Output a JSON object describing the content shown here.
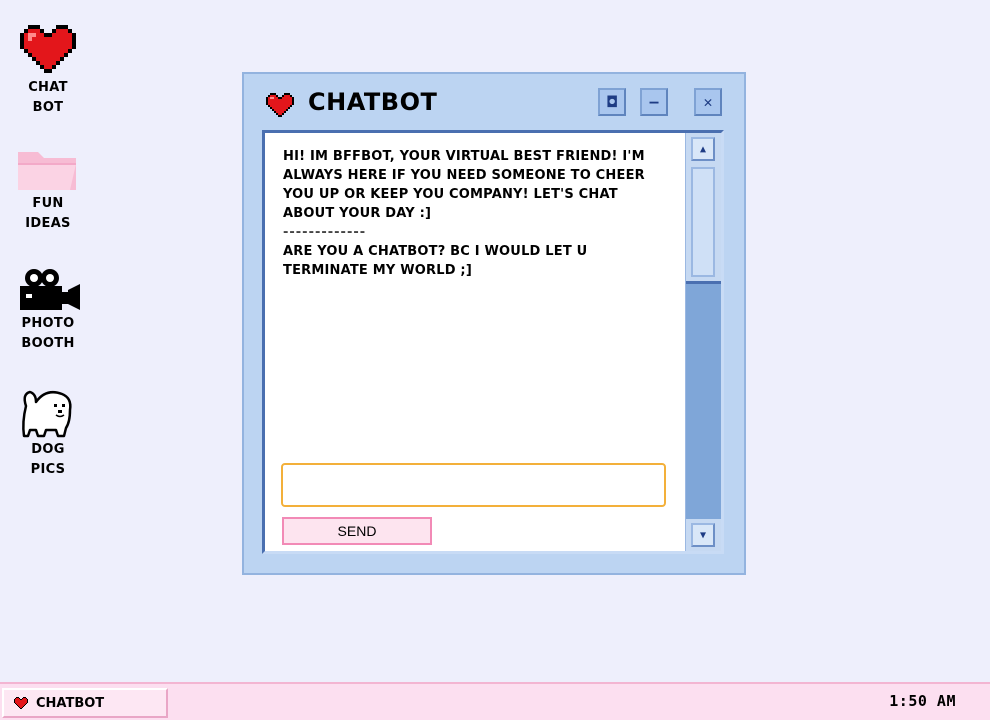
{
  "desktop": {
    "icons": [
      {
        "label": "CHAT\nBOT",
        "icon": "heart-icon"
      },
      {
        "label": "FUN\nIDEAS",
        "icon": "folder-icon"
      },
      {
        "label": "PHOTO\nBOOTH",
        "icon": "camera-icon"
      },
      {
        "label": "DOG\nPICS",
        "icon": "dog-icon"
      }
    ]
  },
  "window": {
    "title": "CHATBOT",
    "buttons": {
      "maximize": "◘",
      "minimize": "–",
      "close": "✕"
    },
    "messages": [
      "HI! IM BFFBOT, YOUR VIRTUAL BEST FRIEND! I'M ALWAYS HERE IF YOU NEED SOMEONE TO CHEER YOU UP OR KEEP YOU COMPANY! LET'S CHAT ABOUT YOUR DAY :]",
      "ARE YOU A CHATBOT? BC I WOULD LET U TERMINATE MY WORLD ;]"
    ],
    "divider": "-------------",
    "input": {
      "value": "",
      "placeholder": ""
    },
    "send_label": "SEND",
    "scroll_up": "▲",
    "scroll_down": "▼"
  },
  "taskbar": {
    "task_label": "CHATBOT",
    "clock": "1:50 AM"
  },
  "colors": {
    "desktop_bg": "#eeeffc",
    "window_bg": "#bcd4f2",
    "heart": "#e3161b",
    "folder": "#f9c6db",
    "input_border": "#f3b03a",
    "send_border": "#f28ab6",
    "taskbar_bg": "#fcdff0"
  }
}
